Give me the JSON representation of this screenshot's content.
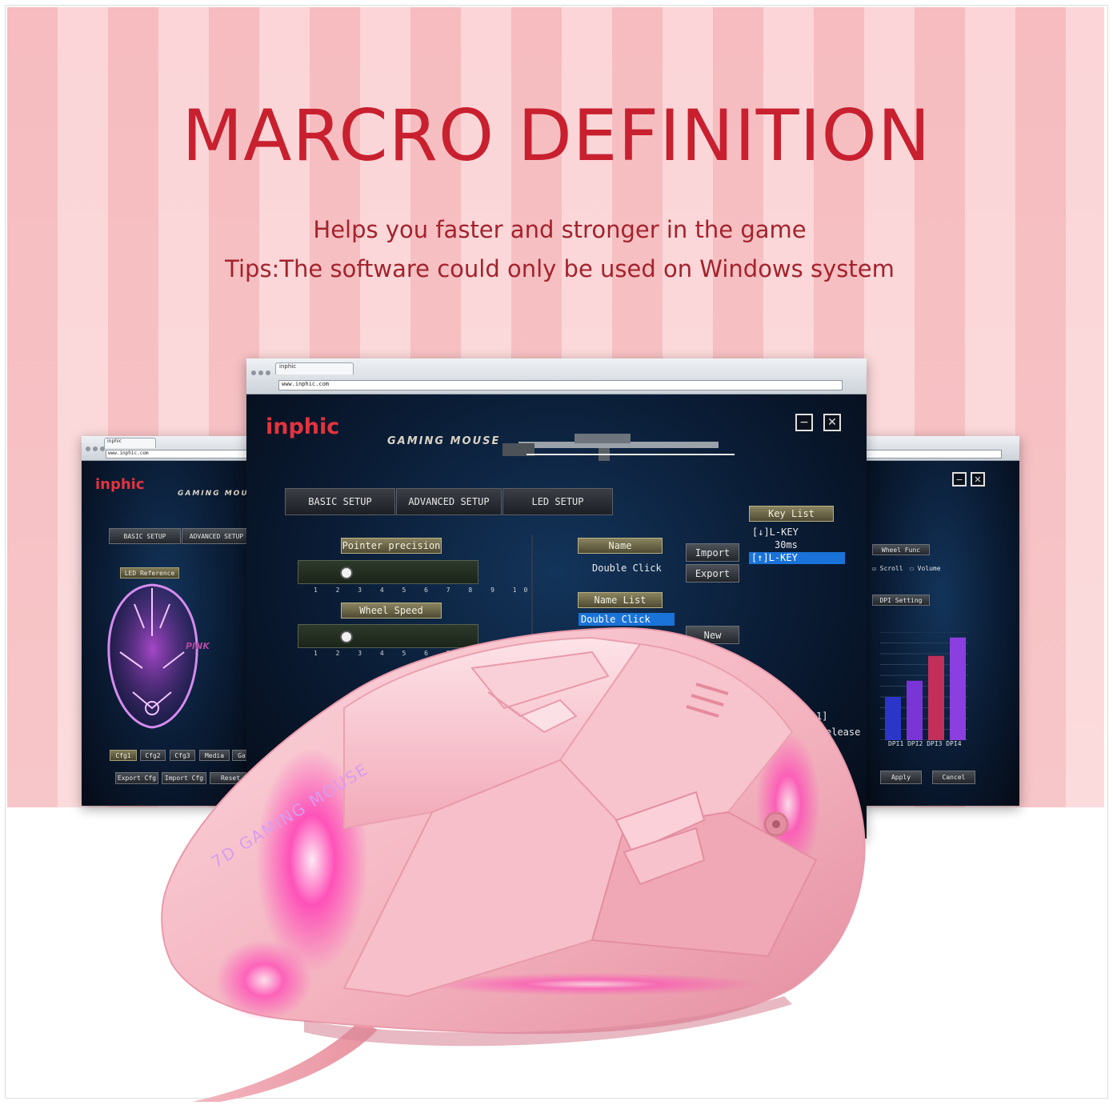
{
  "headline": "MARCRO DEFINITION",
  "subheadline": "Helps you faster and stronger in the game",
  "tips": "Tips:The software could only be used on Windows system",
  "colors": {
    "headline_red": "#c8202f",
    "stripe_dark": "#f6bcbf",
    "stripe_light": "#fbd5d7",
    "brand_red": "#e4333f",
    "selection_blue": "#1a73d9",
    "mouse_pink": "#f5b8c3",
    "glow_magenta": "#ff3fb6"
  },
  "center_window": {
    "tab_label": "inphic",
    "url": "www.inphic.com",
    "brand": "inphic",
    "product_label": "GAMING MOUSE",
    "minimize_icon": "−",
    "close_icon": "✕",
    "tabs": [
      "BASIC SETUP",
      "ADVANCED SETUP",
      "LED SETUP"
    ],
    "pointer_precision_label": "Pointer precision",
    "pointer_precision_value": 3,
    "wheel_speed_label": "Wheel Speed",
    "wheel_speed_value": 3,
    "scale_ticks": "1 2 3 4 5 6 7 8 9 10",
    "name_label": "Name",
    "name_value": "Double Click",
    "name_list_label": "Name List",
    "name_list_selected": "Double Click",
    "import_button": "Import",
    "export_button": "Export",
    "new_button": "New",
    "key_list_label": "Key List",
    "key_list_items": [
      "[↓]L-KEY",
      "30ms",
      "[↑]L-KEY"
    ],
    "partial_text": [
      "1]",
      "elease"
    ]
  },
  "left_window": {
    "tab_label": "inphic",
    "url": "www.inphic.com",
    "brand": "inphic",
    "product_label": "GAMING MOU",
    "tabs": [
      "BASIC SETUP",
      "ADVANCED SETUP"
    ],
    "led_reference_label": "LED Reference",
    "color_name": "PINK",
    "cfg_buttons": [
      "Cfg1",
      "Cfg2",
      "Cfg3",
      "Media",
      "Ga"
    ],
    "bottom_buttons": [
      "Export Cfg",
      "Import Cfg",
      "Reset"
    ]
  },
  "right_window": {
    "minimize_icon": "−",
    "close_icon": "✕",
    "wheel_func_label": "Wheel Func",
    "scroll_option": "Scroll",
    "volume_option": "Volume",
    "dpi_setting_label": "DPI Setting",
    "dpi_names": [
      "DPI1",
      "DPI2",
      "DPI3",
      "DPI4"
    ],
    "dpi_levels": [
      0.4,
      0.55,
      0.78,
      0.95
    ],
    "apply_button": "Apply",
    "cancel_button": "Cancel"
  },
  "mouse": {
    "side_text": "7D GAMING MOUSE"
  }
}
